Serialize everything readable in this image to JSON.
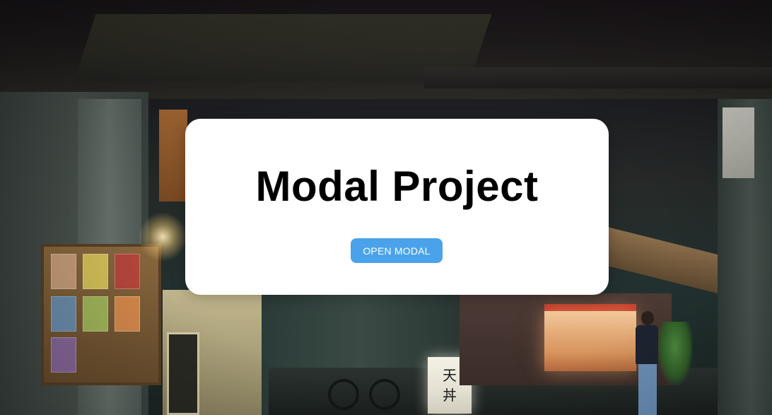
{
  "page": {
    "title": "Modal Project",
    "open_button_label": "OPEN MODAL"
  },
  "background": {
    "description_icon": "night-alley-photo",
    "sign_characters": "天\n丼"
  },
  "colors": {
    "button_bg": "#4aa3ea",
    "button_text": "#ffffff",
    "card_bg": "#ffffff",
    "title_text": "#000000"
  }
}
